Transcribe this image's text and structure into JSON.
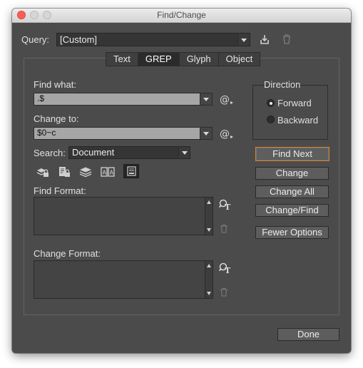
{
  "window": {
    "title": "Find/Change"
  },
  "query": {
    "label": "Query:",
    "value": "[Custom]",
    "save_icon": "save-query-icon",
    "delete_icon": "trash-icon"
  },
  "tabs": [
    {
      "label": "Text",
      "active": false
    },
    {
      "label": "GREP",
      "active": true
    },
    {
      "label": "Glyph",
      "active": false
    },
    {
      "label": "Object",
      "active": false
    }
  ],
  "find": {
    "label": "Find what:",
    "value": ".$",
    "special_icon": "at-symbol-icon"
  },
  "change": {
    "label": "Change to:",
    "value": "$0~c",
    "special_icon": "at-symbol-icon"
  },
  "search": {
    "label": "Search:",
    "value": "Document"
  },
  "search_options": [
    {
      "icon": "include-locked-layers-icon"
    },
    {
      "icon": "include-locked-stories-icon"
    },
    {
      "icon": "include-hidden-layers-icon"
    },
    {
      "icon": "include-master-pages-icon"
    },
    {
      "icon": "include-footnotes-icon",
      "active": true
    }
  ],
  "find_format": {
    "label": "Find Format:",
    "value": ""
  },
  "change_format": {
    "label": "Change Format:",
    "value": ""
  },
  "direction": {
    "label": "Direction",
    "options": [
      {
        "label": "Forward",
        "selected": true
      },
      {
        "label": "Backward",
        "selected": false
      }
    ]
  },
  "buttons": {
    "find_next": "Find Next",
    "change": "Change",
    "change_all": "Change All",
    "change_find": "Change/Find",
    "fewer_options": "Fewer Options",
    "done": "Done"
  },
  "colors": {
    "dialog_bg": "#4b4b4b",
    "focus_ring": "#d9822b",
    "field_bg": "#a6a6a6"
  }
}
